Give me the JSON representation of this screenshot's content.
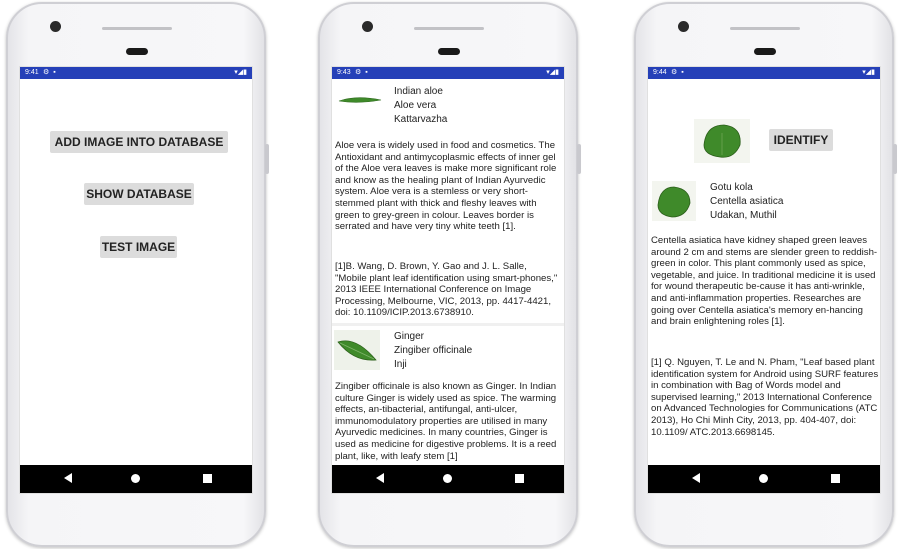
{
  "screen1": {
    "status_time": "9:41",
    "buttons": {
      "add": "ADD IMAGE INTO DATABASE",
      "show": "SHOW DATABASE",
      "test": "TEST IMAGE"
    }
  },
  "screen2": {
    "status_time": "9:43",
    "plants": [
      {
        "names": [
          "Indian aloe",
          "Aloe vera",
          "Kattarvazha"
        ],
        "description": "Aloe vera is widely used in food and cosmetics. The Antioxidant and antimycoplasmic effects of  inner gel of the Aloe vera leaves is make more significant role and know as the healing plant of Indian Ayurvedic system. Aloe vera is a stemless or very short-stemmed plant with thick and fleshy leaves with green to grey-green in colour. Leaves border is serrated and have very tiny white teeth [1].",
        "reference": "[1]B. Wang, D. Brown, Y. Gao and J. L. Salle, \"Mobile plant leaf identification using smart-phones,\" 2013 IEEE International Conference on Image Processing, Melbourne, VIC, 2013, pp. 4417-4421, doi: 10.1109/ICIP.2013.6738910."
      },
      {
        "names": [
          "Ginger",
          "Zingiber officinale",
          "Inji"
        ],
        "description": "Zingiber officinale is also known as Ginger. In Indian culture Ginger is widely used as spice. The warming effects, an-tibacterial, antifungal, anti-ulcer, immunomodulatory properties are utilised in many Ayurvedic medicines. In many countries, Ginger is used as medicine for digestive problems. It is a reed plant, like, with leafy stem [1]"
      }
    ]
  },
  "screen3": {
    "status_time": "9:44",
    "identify_label": "IDENTIFY",
    "result": {
      "names": [
        "Gotu kola",
        "Centella asiatica",
        "Udakan, Muthil"
      ],
      "description": "Centella asiatica have kidney shaped green leaves around 2 cm and stems are slender green to reddish-green in color. This plant commonly used as spice, vegetable, and juice. In traditional medicine it is used for wound therapeutic be-cause it has anti-wrinkle, and anti-inflammation properties. Researches are going over Centella asiatica's memory en-hancing and brain enlightening roles [1].",
      "reference": "[1] Q. Nguyen, T. Le and N. Pham, \"Leaf based plant identification system for Android using SURF features in combination with Bag of Words model and supervised learning,\" 2013 International Conference on Advanced Technologies for Communications (ATC 2013), Ho Chi Minh City, 2013, pp. 404-407, doi: 10.1109/ ATC.2013.6698145."
    }
  },
  "icons": [
    "camera-icon",
    "wifi-icon",
    "signal-icon",
    "battery-icon",
    "back-icon",
    "home-icon",
    "recents-icon",
    "aloe-leaf-icon",
    "ginger-leaf-icon",
    "gotu-kola-leaf-icon"
  ],
  "colors": {
    "status_bar": "#2540b8",
    "nav_bar": "#000000",
    "button_bg": "#dcdcdc",
    "leaf_green": "#3f8a2a"
  }
}
